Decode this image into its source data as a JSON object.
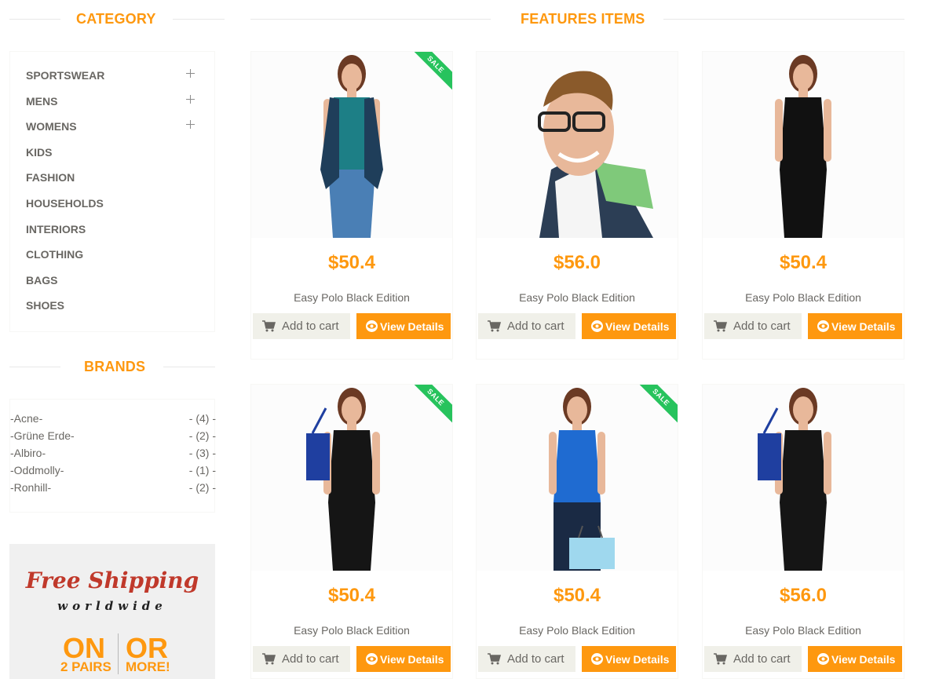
{
  "sidebar": {
    "category_title": "CATEGORY",
    "categories": [
      {
        "label": "SPORTSWEAR",
        "expandable": true
      },
      {
        "label": "MENS",
        "expandable": true
      },
      {
        "label": "WOMENS",
        "expandable": true
      },
      {
        "label": "KIDS",
        "expandable": false
      },
      {
        "label": "FASHION",
        "expandable": false
      },
      {
        "label": "HOUSEHOLDS",
        "expandable": false
      },
      {
        "label": "INTERIORS",
        "expandable": false
      },
      {
        "label": "CLOTHING",
        "expandable": false
      },
      {
        "label": "BAGS",
        "expandable": false
      },
      {
        "label": "SHOES",
        "expandable": false
      }
    ],
    "brands_title": "BRANDS",
    "brands": [
      {
        "name": "-Acne-",
        "count": "- (4) -"
      },
      {
        "name": "-Grüne Erde-",
        "count": "- (2) -"
      },
      {
        "name": "-Albiro-",
        "count": "- (3) -"
      },
      {
        "name": "-Oddmolly-",
        "count": "- (1) -"
      },
      {
        "name": "-Ronhill-",
        "count": "- (2) -"
      }
    ],
    "ad": {
      "line1": "Free Shipping",
      "line2": "worldwide",
      "on": "ON",
      "or": "OR",
      "pairs": "2 PAIRS",
      "more": "MORE!"
    }
  },
  "main": {
    "title": "FEATURES ITEMS",
    "products": [
      {
        "price": "$50.4",
        "name": "Easy Polo Black Edition",
        "sale": true,
        "model": "woman-denim"
      },
      {
        "price": "$56.0",
        "name": "Easy Polo Black Edition",
        "sale": false,
        "model": "man-glasses"
      },
      {
        "price": "$50.4",
        "name": "Easy Polo Black Edition",
        "sale": false,
        "model": "woman-black-dress"
      },
      {
        "price": "$50.4",
        "name": "Easy Polo Black Edition",
        "sale": true,
        "model": "woman-bag"
      },
      {
        "price": "$50.4",
        "name": "Easy Polo Black Edition",
        "sale": true,
        "model": "woman-blue-top"
      },
      {
        "price": "$56.0",
        "name": "Easy Polo Black Edition",
        "sale": false,
        "model": "woman-bag"
      }
    ],
    "add_to_cart_label": "Add to cart",
    "view_details_label": "View Details",
    "sale_label": "SALE"
  },
  "colors": {
    "accent": "#fe980f",
    "sale": "#27c35d",
    "text": "#696763",
    "button_bg": "#f0f0e9"
  }
}
